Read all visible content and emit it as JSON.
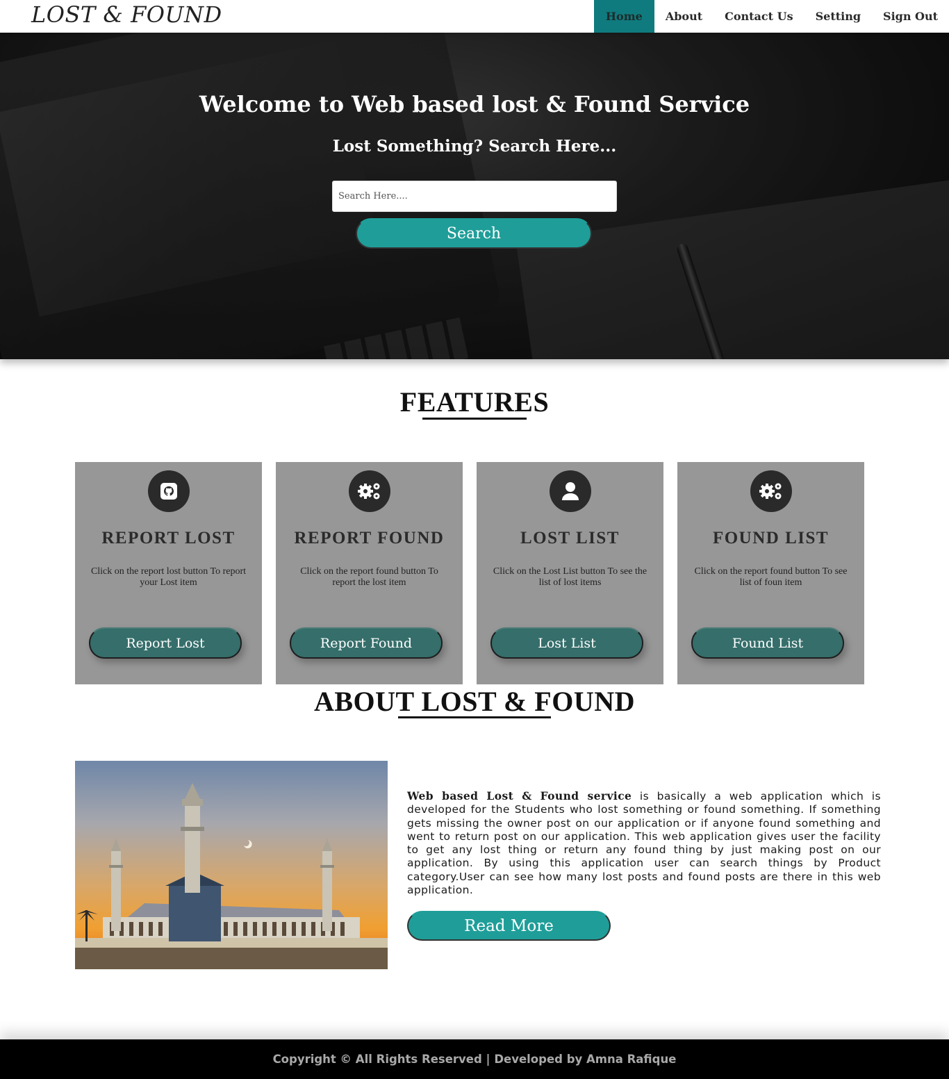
{
  "navbar": {
    "logo": "LOST & FOUND",
    "items": [
      {
        "label": "Home",
        "active": true
      },
      {
        "label": "About",
        "active": false
      },
      {
        "label": "Contact Us",
        "active": false
      },
      {
        "label": "Setting",
        "active": false
      },
      {
        "label": "Sign Out",
        "active": false
      }
    ]
  },
  "hero": {
    "title": "Welcome to Web based lost & Found Service",
    "subtitle": "Lost Something? Search Here...",
    "search_placeholder": "Search Here....",
    "search_button": "Search"
  },
  "features": {
    "heading": "FEATURES",
    "cards": [
      {
        "icon": "github-icon",
        "title": "REPORT LOST",
        "text": "Click on the report lost button To report your Lost item",
        "button": "Report Lost"
      },
      {
        "icon": "cogs-icon",
        "title": "REPORT FOUND",
        "text": "Click on the report found button To report the lost item",
        "button": "Report Found"
      },
      {
        "icon": "user-icon",
        "title": "LOST LIST",
        "text": "Click on the Lost List button To see the list of lost items",
        "button": "Lost List"
      },
      {
        "icon": "cogs-icon",
        "title": "FOUND LIST",
        "text": "Click on the report found button To see list of foun item",
        "button": "Found List"
      }
    ]
  },
  "about": {
    "heading": "ABOUT LOST & FOUND",
    "bold_lead": "Web based Lost & Found service",
    "body": " is basically a web application which is developed for the Students who lost something or found something. If something gets missing the owner post on our application or if anyone found something and went to return post on our application. This web application gives user the facility to get any lost thing or return any found thing by just making post on our application. By using this application user can search things by Product category.User can see how many lost posts and found posts are there in this web application.",
    "button": "Read More"
  },
  "footer": {
    "text": "Copyright © All Rights Reserved | Developed by Amna Rafique"
  },
  "colors": {
    "accent": "#1f9e99",
    "nav_active": "#0f7b7e",
    "card_bg": "#979797",
    "card_button": "#356e6a"
  }
}
